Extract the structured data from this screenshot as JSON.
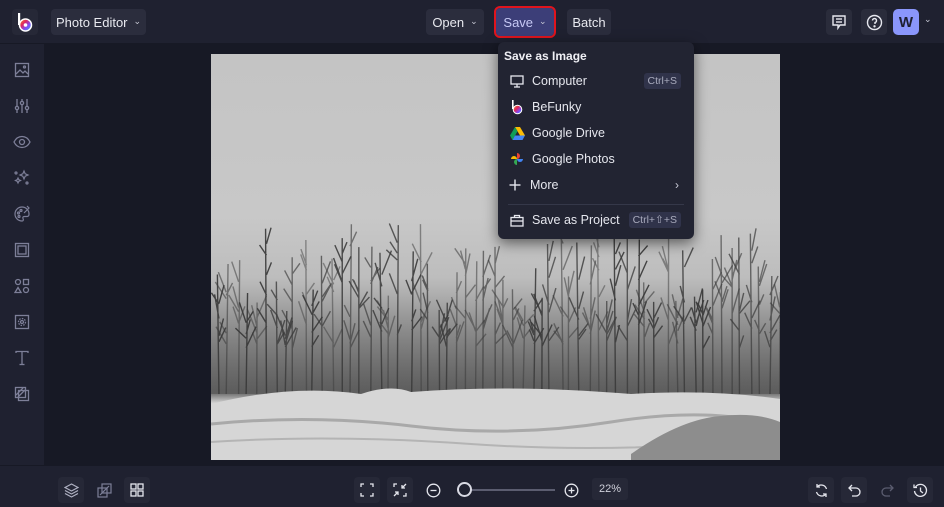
{
  "topbar": {
    "app_menu_label": "Photo Editor",
    "open_label": "Open",
    "save_label": "Save",
    "batch_label": "Batch",
    "avatar_initial": "W",
    "icons": [
      "befunky-logo-icon",
      "feedback-icon",
      "help-icon",
      "chevron-down-icon"
    ]
  },
  "sidebar": {
    "items": [
      {
        "name": "image-manager",
        "icon": "image-icon"
      },
      {
        "name": "edit",
        "icon": "sliders-icon"
      },
      {
        "name": "touch-up",
        "icon": "eye-icon"
      },
      {
        "name": "effects",
        "icon": "sparkle-icon"
      },
      {
        "name": "artsy",
        "icon": "palette-icon"
      },
      {
        "name": "frames",
        "icon": "frame-icon"
      },
      {
        "name": "graphics",
        "icon": "shapes-icon"
      },
      {
        "name": "overlays",
        "icon": "overlay-icon"
      },
      {
        "name": "text",
        "icon": "text-icon"
      },
      {
        "name": "textures",
        "icon": "texture-icon"
      }
    ]
  },
  "save_menu": {
    "heading": "Save as Image",
    "items": [
      {
        "label": "Computer",
        "shortcut": "Ctrl+S",
        "icon": "monitor-icon"
      },
      {
        "label": "BeFunky",
        "shortcut": "",
        "icon": "befunky-icon"
      },
      {
        "label": "Google Drive",
        "shortcut": "",
        "icon": "google-drive-icon"
      },
      {
        "label": "Google Photos",
        "shortcut": "",
        "icon": "google-photos-icon"
      },
      {
        "label": "More",
        "shortcut": "",
        "icon": "plus-icon",
        "submenu": true
      }
    ],
    "project_item": {
      "label": "Save as Project",
      "shortcut": "Ctrl+⇧+S",
      "icon": "briefcase-icon"
    }
  },
  "bottombar": {
    "zoom_value": "22%",
    "zoom_fraction": 0.05,
    "left_icons": [
      "layers-icon",
      "compare-icon",
      "grid-icon"
    ],
    "center_icons": [
      "fit-screen-icon",
      "actual-size-icon",
      "zoom-out-icon",
      "zoom-in-icon"
    ],
    "right_icons": [
      "reset-icon",
      "undo-icon",
      "redo-icon",
      "history-icon"
    ]
  },
  "colors": {
    "accent": "#8a96fb",
    "save_highlight": "#e0141d",
    "background": "#1f2130"
  }
}
